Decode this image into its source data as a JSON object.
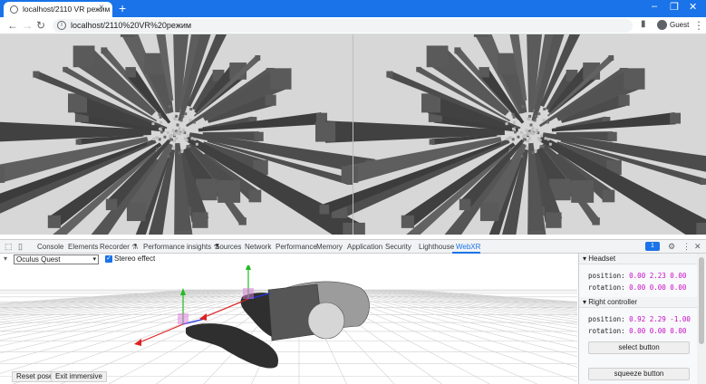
{
  "browser": {
    "tab_title": "localhost/2110 VR режим",
    "tab_close": "×",
    "new_tab": "+",
    "url": "localhost/2110%20VR%20режим",
    "profile": "Guest",
    "window_controls": [
      "–",
      "❐",
      "✕"
    ],
    "accent": "#1a73e8"
  },
  "devtools": {
    "tabs": [
      "Console",
      "Elements",
      "Recorder ⚗",
      "Performance insights ⚗",
      "Sources",
      "Network",
      "Performance",
      "Memory",
      "Application",
      "Security",
      "Lighthouse",
      "WebXR"
    ],
    "active_tab": "WebXR",
    "issues_count": "1",
    "device": "Oculus Quest",
    "stereo_effect_label": "Stereo effect",
    "stereo_effect_checked": true,
    "reset_pose": "Reset pose",
    "exit_immersive": "Exit immersive"
  },
  "panel": {
    "headset": {
      "title": "Headset",
      "position_label": "position:",
      "position_value": "0.00 2.23 0.00",
      "rotation_label": "rotation:",
      "rotation_value": "0.00 0.00 0.00"
    },
    "right_controller": {
      "title": "Right controller",
      "position_label": "position:",
      "position_value": "0.92 2.29 -1.00",
      "rotation_label": "rotation:",
      "rotation_value": "0.00 0.00 0.00"
    },
    "select_button": "select button",
    "squeeze_button": "squeeze button"
  },
  "icons": [
    "page-icon",
    "info-icon",
    "back-icon",
    "forward-icon",
    "reload-icon",
    "inspect-icon",
    "device-toggle-icon",
    "gear-icon",
    "more-icon",
    "close-icon"
  ]
}
